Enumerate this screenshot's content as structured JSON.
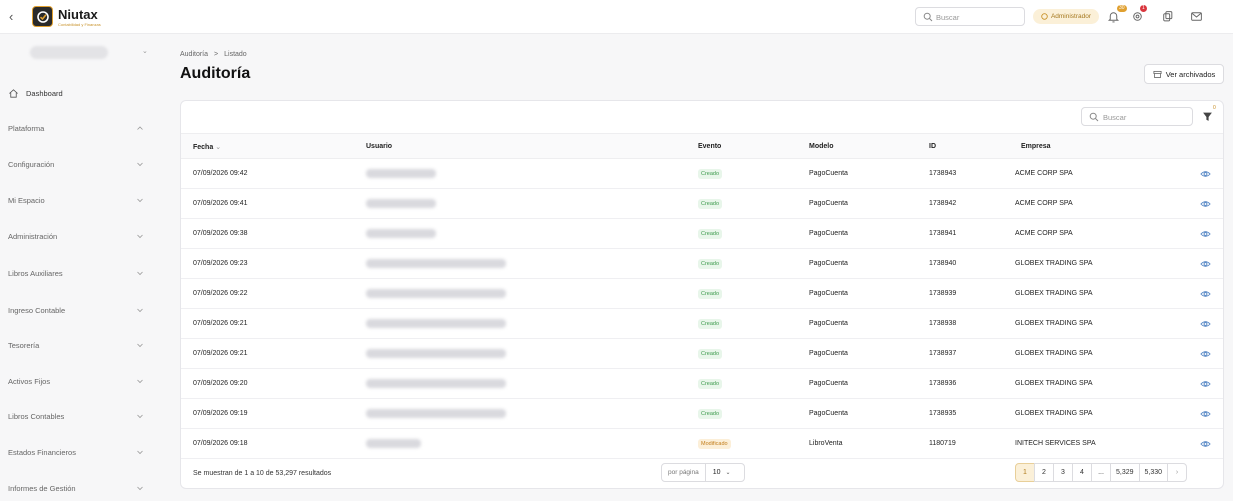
{
  "topbar": {
    "app_name": "Niutax",
    "app_tagline": "Contabilidad y Finanzas",
    "search_placeholder": "Buscar",
    "role_badge": "Administrador",
    "notification_count": "30",
    "alert_count": "1"
  },
  "sidebar": {
    "dashboard_label": "Dashboard",
    "items": [
      {
        "label": "Plataforma",
        "expanded": true
      },
      {
        "label": "Configuración",
        "expanded": false
      },
      {
        "label": "Mi Espacio",
        "expanded": false
      },
      {
        "label": "Administración",
        "expanded": false
      },
      {
        "label": "Libros Auxiliares",
        "expanded": false
      },
      {
        "label": "Ingreso Contable",
        "expanded": false
      },
      {
        "label": "Tesorería",
        "expanded": false
      },
      {
        "label": "Activos Fijos",
        "expanded": false
      },
      {
        "label": "Libros Contables",
        "expanded": false
      },
      {
        "label": "Estados Financieros",
        "expanded": false
      },
      {
        "label": "Informes de Gestión",
        "expanded": false
      }
    ]
  },
  "breadcrumb": {
    "parent": "Auditoría",
    "separator": ">",
    "current": "Listado"
  },
  "page": {
    "title": "Auditoría",
    "archived_button": "Ver archivados",
    "search_placeholder": "Buscar",
    "filter_count": "0"
  },
  "table": {
    "columns": {
      "fecha": "Fecha",
      "usuario": "Usuario",
      "evento": "Evento",
      "modelo": "Modelo",
      "id": "ID",
      "empresa": "Empresa"
    },
    "rows": [
      {
        "fecha": "07/09/2026 09:42",
        "evento": "Creado",
        "modelo": "PagoCuenta",
        "id": "1738943",
        "empresa": "ACME CORP SPA"
      },
      {
        "fecha": "07/09/2026 09:41",
        "evento": "Creado",
        "modelo": "PagoCuenta",
        "id": "1738942",
        "empresa": "ACME CORP SPA"
      },
      {
        "fecha": "07/09/2026 09:38",
        "evento": "Creado",
        "modelo": "PagoCuenta",
        "id": "1738941",
        "empresa": "ACME CORP SPA"
      },
      {
        "fecha": "07/09/2026 09:23",
        "evento": "Creado",
        "modelo": "PagoCuenta",
        "id": "1738940",
        "empresa": "GLOBEX TRADING SPA"
      },
      {
        "fecha": "07/09/2026 09:22",
        "evento": "Creado",
        "modelo": "PagoCuenta",
        "id": "1738939",
        "empresa": "GLOBEX TRADING SPA"
      },
      {
        "fecha": "07/09/2026 09:21",
        "evento": "Creado",
        "modelo": "PagoCuenta",
        "id": "1738938",
        "empresa": "GLOBEX TRADING SPA"
      },
      {
        "fecha": "07/09/2026 09:21",
        "evento": "Creado",
        "modelo": "PagoCuenta",
        "id": "1738937",
        "empresa": "GLOBEX TRADING SPA"
      },
      {
        "fecha": "07/09/2026 09:20",
        "evento": "Creado",
        "modelo": "PagoCuenta",
        "id": "1738936",
        "empresa": "GLOBEX TRADING SPA"
      },
      {
        "fecha": "07/09/2026 09:19",
        "evento": "Creado",
        "modelo": "PagoCuenta",
        "id": "1738935",
        "empresa": "GLOBEX TRADING SPA"
      },
      {
        "fecha": "07/09/2026 09:18",
        "evento": "Modificado",
        "modelo": "LibroVenta",
        "id": "1180719",
        "empresa": "INITECH SERVICES SPA"
      }
    ]
  },
  "footer": {
    "summary": "Se muestran de 1 a 10 de 53,297 resultados",
    "per_page_label": "por página",
    "per_page_value": "10",
    "pages": [
      "1",
      "2",
      "3",
      "4",
      "...",
      "5,329",
      "5,330"
    ],
    "active_page": "1"
  },
  "colors": {
    "accent": "#c8922a",
    "created_bg": "#e8f6ea",
    "created_fg": "#3d9a4d",
    "modified_bg": "#fcefd8",
    "modified_fg": "#c27d1a"
  },
  "icons": [
    "back-icon",
    "logo-icon",
    "search-icon",
    "shield-icon",
    "bell-icon",
    "gear-icon",
    "copy-icon",
    "mail-icon",
    "home-icon",
    "chevron-down-icon",
    "archive-icon",
    "filter-icon",
    "eye-icon"
  ]
}
